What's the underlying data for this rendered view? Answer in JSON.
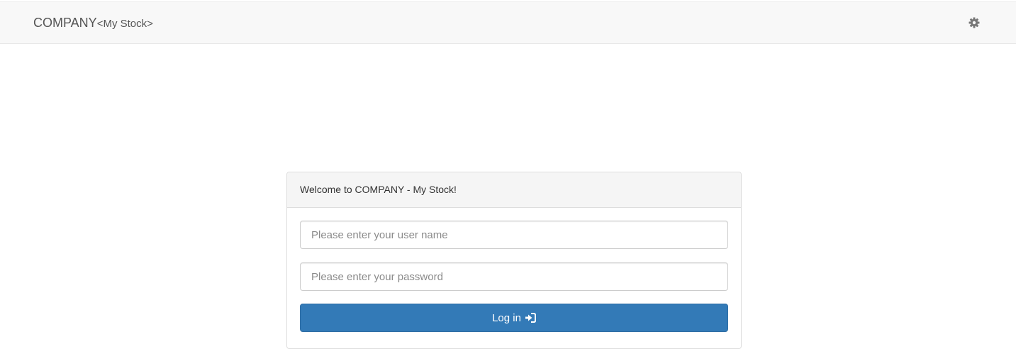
{
  "navbar": {
    "brand": "COMPANY",
    "brand_sub": "<My Stock>",
    "settings_icon": "gear-icon"
  },
  "login_panel": {
    "heading": "Welcome to COMPANY - My Stock!",
    "username_placeholder": "Please enter your user name",
    "username_value": "",
    "password_placeholder": "Please enter your password",
    "password_value": "",
    "login_label": "Log in",
    "login_icon": "log-in-icon"
  },
  "colors": {
    "navbar_bg": "#f8f8f8",
    "primary_button": "#337ab7",
    "panel_heading_bg": "#f5f5f5"
  }
}
